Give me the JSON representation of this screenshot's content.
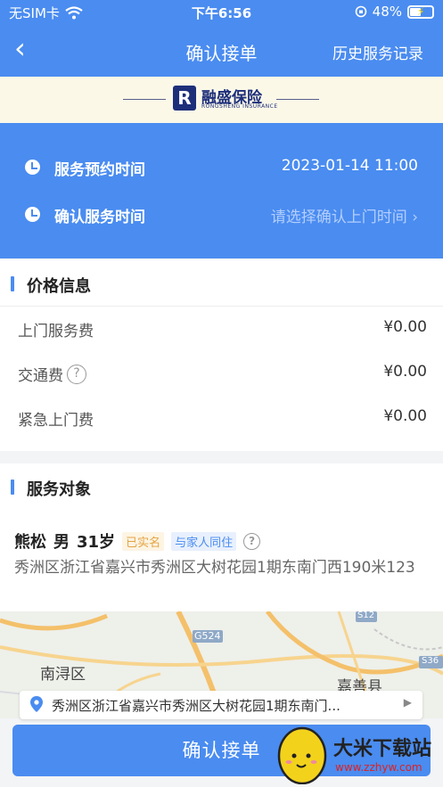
{
  "status_bar": {
    "carrier": "无SIM卡",
    "time": "下午6:56",
    "battery": "48%",
    "battery_level": 0.48
  },
  "nav": {
    "back_icon": "chevron-left-icon",
    "title": "确认接单",
    "history_label": "历史服务记录"
  },
  "brand": {
    "logo_text": "融盛保险",
    "logo_sub": "RONGSHENG INSURANCE",
    "logo_mark": "R"
  },
  "time_card": {
    "appointment_label": "服务预约时间",
    "appointment_value": "2023-01-14 11:00",
    "confirm_label": "确认服务时间",
    "confirm_placeholder": "请选择确认上门时间 ›"
  },
  "price": {
    "section_title": "价格信息",
    "items": [
      {
        "label": "上门服务费",
        "value": "¥0.00"
      },
      {
        "label": "交通费",
        "value": "¥0.00"
      },
      {
        "label": "紧急上门费",
        "value": "¥0.00"
      }
    ]
  },
  "service_target": {
    "section_title": "服务对象",
    "name": "熊松",
    "gender": "男",
    "age": "31岁",
    "tag_verified": "已实名",
    "tag_family": "与家人同住",
    "address": "秀洲区浙江省嘉兴市秀洲区大树花园1期东南门西190米123"
  },
  "map": {
    "labels": [
      "S12",
      "G524",
      "南浔区",
      "嘉善县",
      "S36"
    ],
    "address": "秀洲区浙江省嘉兴市秀洲区大树花园1期东南门..."
  },
  "confirm_button": "确认接单",
  "watermark": {
    "title": "大米下载站",
    "url": "www.zzhyw.com"
  },
  "colors": {
    "primary": "#4a8cf0",
    "gold_tag": "#e3a443"
  }
}
